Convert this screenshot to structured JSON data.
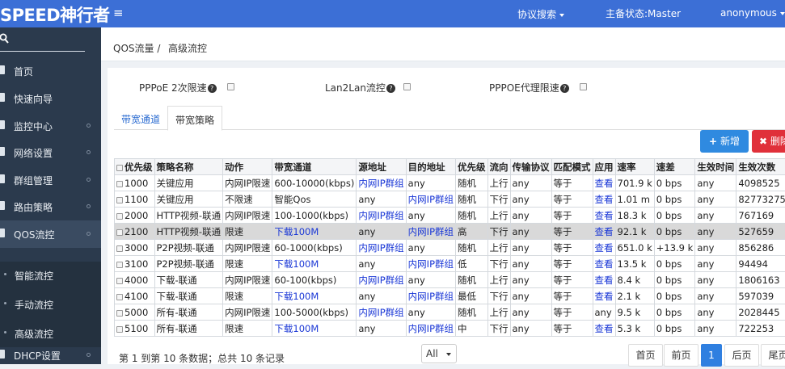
{
  "app": {
    "logo": "SPEED神行者",
    "menu_icon": "≡"
  },
  "topbar": {
    "protocol_search": "协议搜索",
    "status": "主备状态:Master",
    "user": "anonymous"
  },
  "sidebar": {
    "search_placeholder": "",
    "items": [
      {
        "label": "首页",
        "icon": "home-icon"
      },
      {
        "label": "快速向导",
        "icon": "wizard-icon"
      },
      {
        "label": "监控中心",
        "icon": "monitor-icon"
      },
      {
        "label": "网络设置",
        "icon": "network-icon"
      },
      {
        "label": "群组管理",
        "icon": "group-icon"
      },
      {
        "label": "路由策略",
        "icon": "route-icon"
      },
      {
        "label": "QOS流控",
        "icon": "qos-icon"
      },
      {
        "label": "DHCP设置",
        "icon": "dhcp-icon"
      }
    ],
    "sub_items": [
      {
        "label": "智能流控"
      },
      {
        "label": "手动流控"
      },
      {
        "label": "高级流控"
      }
    ]
  },
  "breadcrumb": {
    "parent": "QOS流量 /",
    "current": "高级流控"
  },
  "options": {
    "pppoe": "PPPoE 2次限速",
    "lan2lan": "Lan2Lan流控",
    "pppoe_proxy": "PPPOE代理限速"
  },
  "tabs": {
    "channel": "带宽通道",
    "policy": "带宽策略"
  },
  "actions": {
    "add": "新增",
    "delete": "删除"
  },
  "table": {
    "headers": [
      "优先级",
      "策略名称",
      "动作",
      "带宽通道",
      "源地址",
      "目的地址",
      "优先级",
      "流向",
      "传输协议",
      "匹配模式",
      "应用",
      "速率",
      "速差",
      "生效时间",
      "生效次数"
    ],
    "rows": [
      [
        "1000",
        "关键应用",
        "内网IP限速",
        "600-10000(kbps)",
        "内网IP群组",
        "any",
        "随机",
        "上行",
        "any",
        "等于",
        "查看",
        "701.9 k",
        "0 bps",
        "any",
        "4098525"
      ],
      [
        "1100",
        "关键应用",
        "不限速",
        "智能Qos",
        "any",
        "内网IP群组",
        "随机",
        "下行",
        "any",
        "等于",
        "查看",
        "1.01 m",
        "0 bps",
        "any",
        "82773275"
      ],
      [
        "2000",
        "HTTP视频-联通",
        "内网IP限速",
        "100-1000(kbps)",
        "内网IP群组",
        "any",
        "随机",
        "上行",
        "any",
        "等于",
        "查看",
        "18.3 k",
        "0 bps",
        "any",
        "767169"
      ],
      [
        "2100",
        "HTTP视频-联通",
        "限速",
        "下载100M",
        "any",
        "内网IP群组",
        "高",
        "下行",
        "any",
        "等于",
        "查看",
        "92.1 k",
        "0 bps",
        "any",
        "527659"
      ],
      [
        "3000",
        "P2P视频-联通",
        "内网IP限速",
        "60-1000(kbps)",
        "内网IP群组",
        "any",
        "随机",
        "上行",
        "any",
        "等于",
        "查看",
        "651.0 k",
        "+13.9 k",
        "any",
        "856286"
      ],
      [
        "3100",
        "P2P视频-联通",
        "限速",
        "下载100M",
        "any",
        "内网IP群组",
        "低",
        "下行",
        "any",
        "等于",
        "查看",
        "13.5 k",
        "0 bps",
        "any",
        "94494"
      ],
      [
        "4000",
        "下载-联通",
        "内网IP限速",
        "60-100(kbps)",
        "内网IP群组",
        "any",
        "随机",
        "上行",
        "any",
        "等于",
        "查看",
        "8.4 k",
        "0 bps",
        "any",
        "1806163"
      ],
      [
        "4100",
        "下载-联通",
        "限速",
        "下载100M",
        "any",
        "内网IP群组",
        "最低",
        "下行",
        "any",
        "等于",
        "查看",
        "2.1 k",
        "0 bps",
        "any",
        "597039"
      ],
      [
        "5000",
        "所有-联通",
        "内网IP限速",
        "100-5000(kbps)",
        "内网IP群组",
        "any",
        "随机",
        "上行",
        "any",
        "等于",
        "any",
        "9.5 k",
        "0 bps",
        "any",
        "2028445"
      ],
      [
        "5100",
        "所有-联通",
        "限速",
        "下载100M",
        "any",
        "内网IP群组",
        "中",
        "下行",
        "any",
        "等于",
        "查看",
        "5.3 k",
        "0 bps",
        "any",
        "722253"
      ]
    ]
  },
  "pager": {
    "info": "第 1 到第 10 条数据；总共 10 条记录",
    "page_size": "All",
    "first": "首页",
    "prev": "前页",
    "current": "1",
    "next": "后页",
    "last": "尾页"
  },
  "colors": {
    "topbar": "#3c6fd6",
    "sidebar": "#2b3a4d",
    "link": "#1a37d6",
    "add": "#2f8ae0",
    "delete": "#e0303a"
  }
}
